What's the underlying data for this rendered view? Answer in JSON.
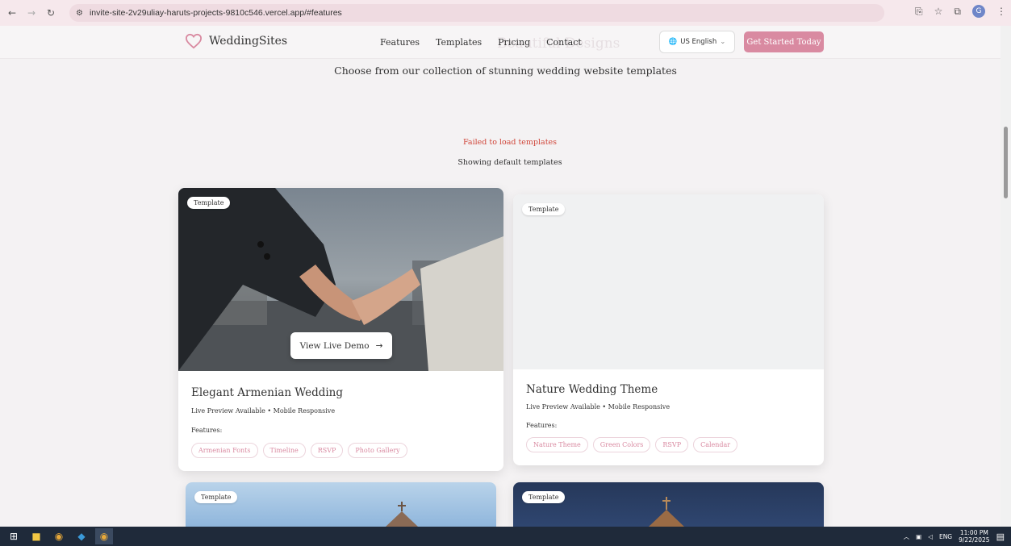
{
  "browser": {
    "url": "invite-site-2v29uliay-haruts-projects-9810c546.vercel.app/#features",
    "profile_initial": "G"
  },
  "header": {
    "brand": "WeddingSites",
    "nav": [
      "Features",
      "Templates",
      "Pricing",
      "Contact"
    ],
    "language": "US English",
    "cta": "Get Started Today",
    "faded_title": "Beautiful Designs"
  },
  "section": {
    "subtitle": "Choose from our collection of stunning wedding website templates",
    "error": "Failed to load templates",
    "fallback": "Showing default templates"
  },
  "cards": [
    {
      "badge": "Template",
      "title": "Elegant Armenian Wedding",
      "meta": "Live Preview Available • Mobile Responsive",
      "features_label": "Features:",
      "tags": [
        "Armenian Fonts",
        "Timeline",
        "RSVP",
        "Photo Gallery"
      ],
      "demo_label": "View Live Demo"
    },
    {
      "badge": "Template",
      "title": "Nature Wedding Theme",
      "meta": "Live Preview Available • Mobile Responsive",
      "features_label": "Features:",
      "tags": [
        "Nature Theme",
        "Green Colors",
        "RSVP",
        "Calendar"
      ]
    },
    {
      "badge": "Template"
    },
    {
      "badge": "Template"
    }
  ],
  "taskbar": {
    "lang": "ENG",
    "time": "11:00 PM",
    "date": "9/22/2025"
  },
  "colors": {
    "accent": "#d98aa1",
    "error": "#d0463a"
  }
}
